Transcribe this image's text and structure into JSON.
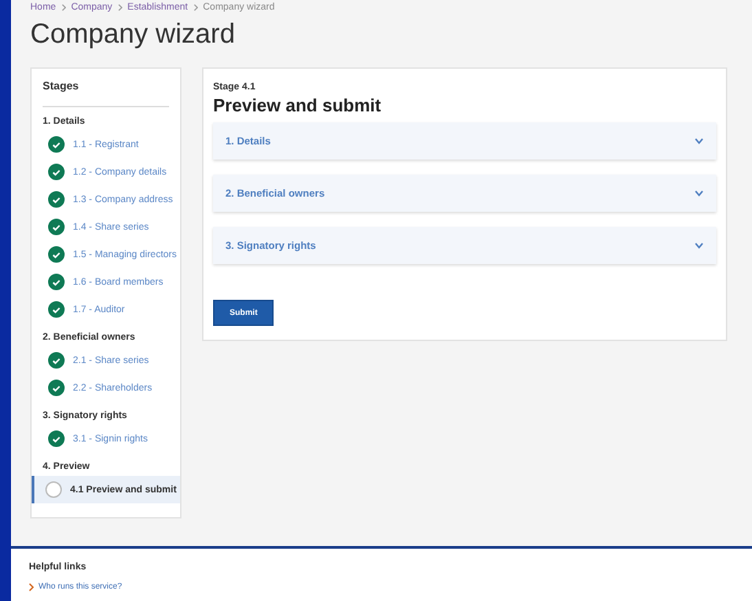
{
  "breadcrumb": [
    "Home",
    "Company",
    "Establishment",
    "Company wizard"
  ],
  "title": "Company wizard",
  "stages": {
    "heading": "Stages",
    "groups": [
      {
        "title": "1. Details",
        "steps": [
          {
            "label": "1.1 - Registrant",
            "done": true,
            "selected": false
          },
          {
            "label": "1.2 - Company details",
            "done": true,
            "selected": false
          },
          {
            "label": "1.3 - Company address",
            "done": true,
            "selected": false
          },
          {
            "label": "1.4 - Share series",
            "done": true,
            "selected": false
          },
          {
            "label": "1.5 - Managing directors",
            "done": true,
            "selected": false
          },
          {
            "label": "1.6 - Board members",
            "done": true,
            "selected": false
          },
          {
            "label": "1.7 - Auditor",
            "done": true,
            "selected": false
          }
        ]
      },
      {
        "title": "2. Beneficial owners",
        "steps": [
          {
            "label": "2.1 - Share series",
            "done": true,
            "selected": false
          },
          {
            "label": "2.2 - Shareholders",
            "done": true,
            "selected": false
          }
        ]
      },
      {
        "title": "3. Signatory rights",
        "steps": [
          {
            "label": "3.1 - Signin rights",
            "done": true,
            "selected": false
          }
        ]
      },
      {
        "title": "4. Preview",
        "steps": [
          {
            "label": "4.1 Preview and submit",
            "done": false,
            "selected": true
          }
        ]
      }
    ]
  },
  "main": {
    "stage_label": "Stage 4.1",
    "heading": "Preview and submit",
    "sections": [
      {
        "label": "1. Details",
        "expanded": false
      },
      {
        "label": "2. Beneficial owners",
        "expanded": false
      },
      {
        "label": "3. Signatory rights",
        "expanded": false
      }
    ],
    "submit": "Submit"
  },
  "footer": {
    "heading": "Helpful links",
    "links": [
      "Who runs this service?"
    ]
  }
}
